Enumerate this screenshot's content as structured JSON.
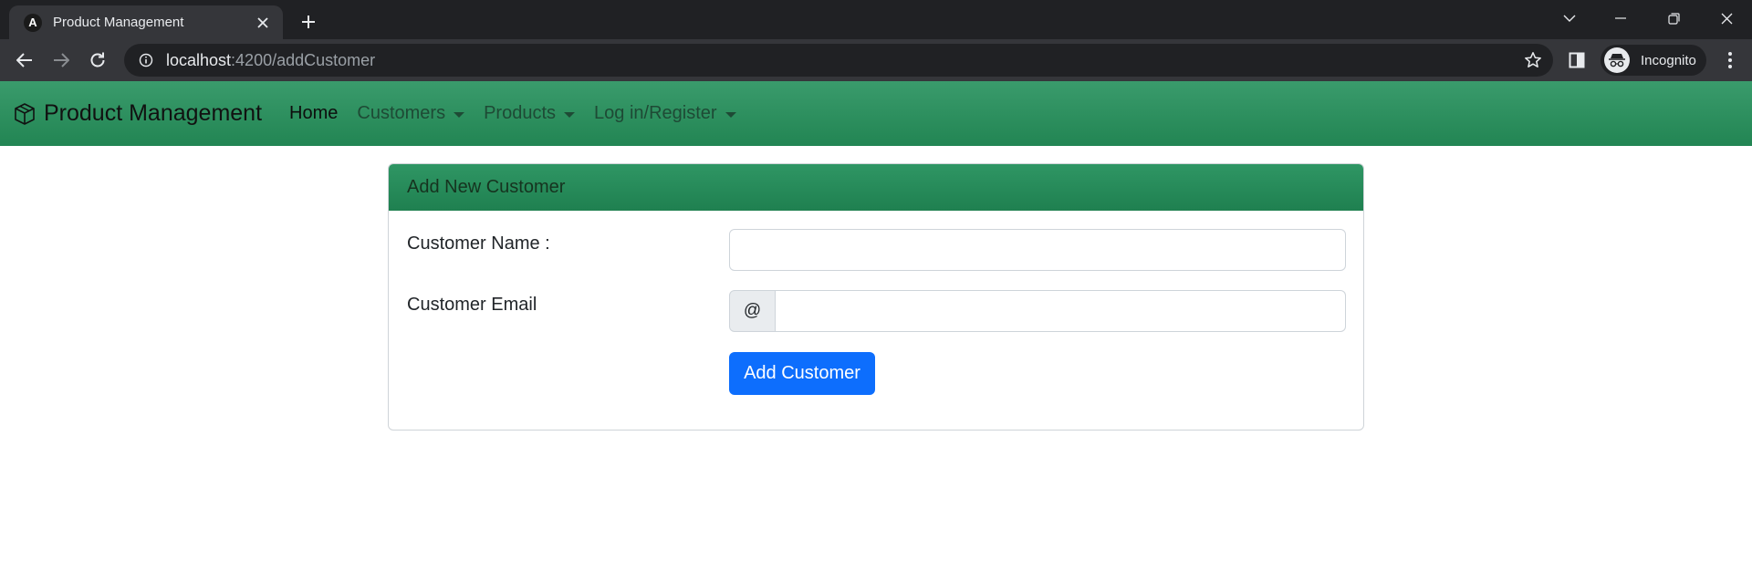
{
  "browser": {
    "tab_title": "Product Management",
    "tab_favicon_letter": "A",
    "url_host": "localhost",
    "url_path": ":4200/addCustomer",
    "profile_label": "Incognito"
  },
  "navbar": {
    "brand": "Product Management",
    "items": [
      {
        "label": "Home",
        "dropdown": false
      },
      {
        "label": "Customers",
        "dropdown": true
      },
      {
        "label": "Products",
        "dropdown": true
      },
      {
        "label": "Log in/Register",
        "dropdown": true
      }
    ]
  },
  "form": {
    "header": "Add New Customer",
    "name_label": "Customer Name :",
    "name_value": "",
    "email_label": "Customer Email",
    "email_addon": "@",
    "email_value": "",
    "submit_label": "Add Customer"
  },
  "colors": {
    "navbar_green": "#228553",
    "button_blue": "#0d6efd"
  }
}
